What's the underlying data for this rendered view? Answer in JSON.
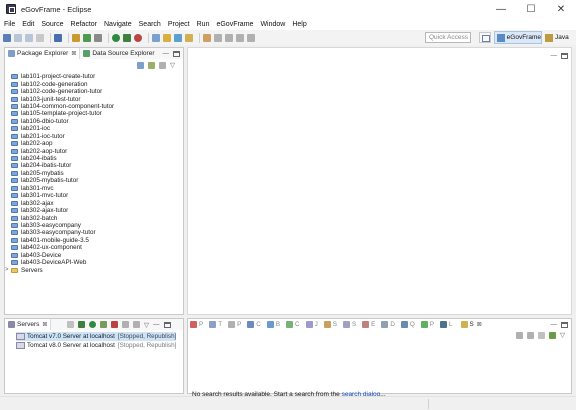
{
  "window": {
    "title": "eGovFrame - Eclipse",
    "controls": {
      "minimize": "—",
      "maximize": "☐",
      "close": "✕"
    }
  },
  "menu": [
    "File",
    "Edit",
    "Source",
    "Refactor",
    "Navigate",
    "Search",
    "Project",
    "Run",
    "eGovFrame",
    "Window",
    "Help"
  ],
  "toolbar": {
    "quick_access_placeholder": "Quick Access",
    "perspectives": [
      {
        "label": "eGovFrame",
        "active": true,
        "icon": "egovframe-perspective-icon"
      },
      {
        "label": "Java",
        "active": false,
        "icon": "java-perspective-icon"
      }
    ]
  },
  "package_explorer": {
    "tabs": [
      {
        "label": "Package Explorer",
        "icon": "package-explorer-icon",
        "close": "⊠",
        "active": true
      },
      {
        "label": "Data Source Explorer",
        "icon": "data-source-icon",
        "active": false
      }
    ],
    "projects": [
      "lab101-project-create-tutor",
      "lab102-code-generation",
      "lab102-code-generation-tutor",
      "lab103-junit-test-tutor",
      "lab104-common-component-tutor",
      "lab105-template-project-tutor",
      "lab106-dbio-tutor",
      "lab201-ioc",
      "lab201-ioc-tutor",
      "lab202-aop",
      "lab202-aop-tutor",
      "lab204-ibatis",
      "lab204-ibatis-tutor",
      "lab205-mybatis",
      "lab205-mybatis-tutor",
      "lab301-mvc",
      "lab301-mvc-tutor",
      "lab302-ajax",
      "lab302-ajax-tutor",
      "lab302-batch",
      "lab303-easycompany",
      "lab303-easycompany-tutor",
      "lab401-mobile-guide-3.5",
      "lab402-ux-component",
      "lab403-Device",
      "lab403-DeviceAPI-Web"
    ],
    "folders": [
      {
        "label": "Servers",
        "twisty": ">"
      }
    ]
  },
  "servers_view": {
    "tab_label": "Servers",
    "tab_close": "⊠",
    "servers": [
      {
        "name": "Tomcat v7.0 Server at localhost",
        "status": "[Stopped, Republish]",
        "selected": true
      },
      {
        "name": "Tomcat v8.0 Server at localhost",
        "status": "[Stopped, Republish]",
        "selected": false
      }
    ]
  },
  "search_view": {
    "tabs": [
      {
        "label": "P",
        "icon": "problems-icon",
        "active": false
      },
      {
        "label": "T",
        "icon": "tasks-icon",
        "active": false
      },
      {
        "label": "P",
        "icon": "properties-icon",
        "active": false
      },
      {
        "label": "C",
        "icon": "console-icon",
        "active": false
      },
      {
        "label": "B",
        "icon": "bookmarks-icon",
        "active": false
      },
      {
        "label": "C",
        "icon": "call-hierarchy-icon",
        "active": false
      },
      {
        "label": "J",
        "icon": "javadoc-icon",
        "active": false
      },
      {
        "label": "S",
        "icon": "snippets-icon",
        "active": false
      },
      {
        "label": "S",
        "icon": "svn-icon",
        "active": false
      },
      {
        "label": "E",
        "icon": "error-log-icon",
        "active": false
      },
      {
        "label": "D",
        "icon": "debug-icon",
        "active": false
      },
      {
        "label": "Q",
        "icon": "sql-results-icon",
        "active": false
      },
      {
        "label": "P",
        "icon": "progress-icon",
        "active": false
      },
      {
        "label": "L",
        "icon": "history-icon",
        "active": false
      },
      {
        "label": "S",
        "icon": "search-view-icon",
        "active": true,
        "close": "⊠"
      }
    ],
    "message": "No search results available. Start a search from the",
    "link": "search dialog",
    "link_suffix": "..."
  },
  "panel_controls": {
    "minimize": "—",
    "menu": "▽"
  },
  "colors": {
    "selection": "#cde3f8",
    "link": "#1a4fc2",
    "status_gray": "#7a7a7a",
    "perspective_active": "#dbe8f7"
  }
}
